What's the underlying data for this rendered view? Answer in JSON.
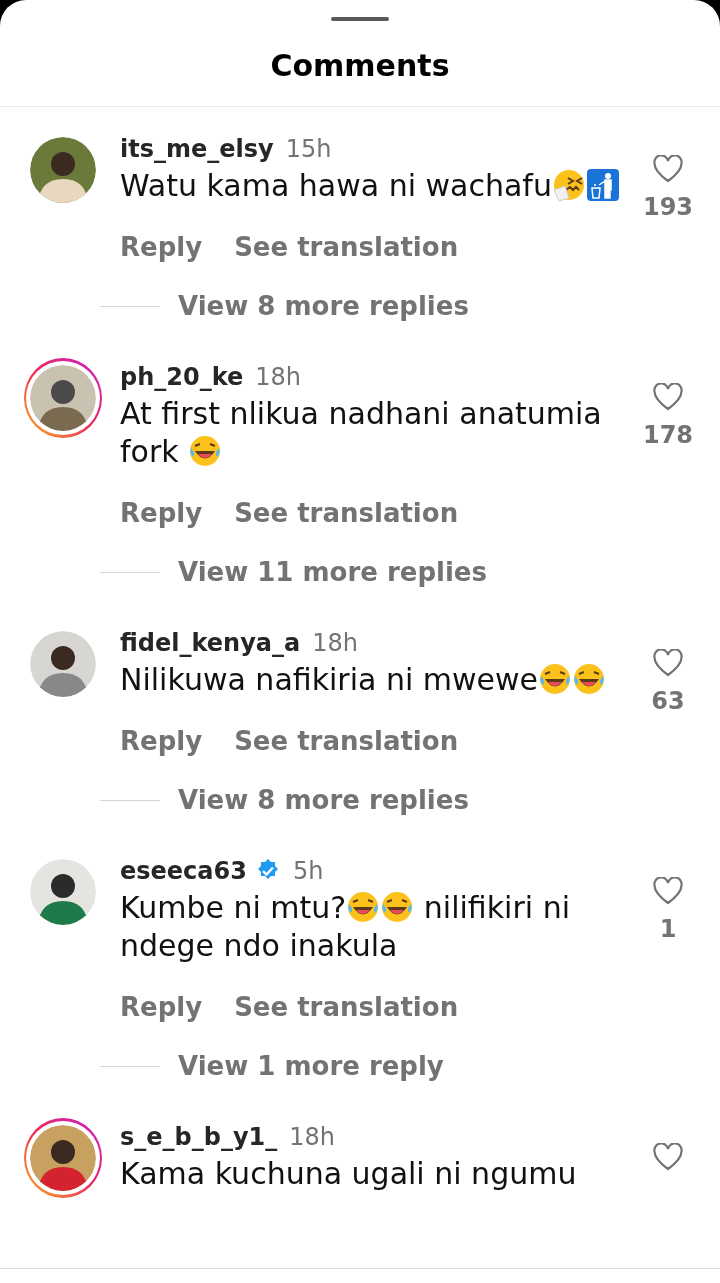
{
  "header": {
    "title": "Comments"
  },
  "comments": [
    {
      "username": "its_me_elsy",
      "verified": false,
      "time": "15h",
      "has_story": false,
      "liked": false,
      "likes": "193",
      "text": [
        {
          "kind": "text",
          "text": "Watu kama hawa ni wachafu"
        },
        {
          "kind": "sneeze"
        },
        {
          "kind": "litter"
        }
      ],
      "actions": [
        "Reply",
        "See translation"
      ],
      "replies": "View 8 more replies"
    },
    {
      "username": "ph_20_ke",
      "verified": false,
      "time": "18h",
      "has_story": true,
      "liked": false,
      "likes": "178",
      "text": [
        {
          "kind": "text",
          "text": "At first nlikua nadhani anatumia"
        },
        {
          "kind": "text",
          "text": "fork "
        },
        {
          "kind": "laugh"
        }
      ],
      "actions": [
        "Reply",
        "See translation"
      ],
      "replies": "View 11 more replies"
    },
    {
      "username": "fidel_kenya_a",
      "verified": false,
      "time": "18h",
      "has_story": false,
      "liked": false,
      "likes": "63",
      "text": [
        {
          "kind": "text",
          "text": "Nilikuwa nafikiria ni mwewe"
        },
        {
          "kind": "laugh"
        },
        {
          "kind": "laugh"
        }
      ],
      "actions": [
        "Reply",
        "See translation"
      ],
      "replies": "View 8 more replies"
    },
    {
      "username": "eseeca63",
      "verified": true,
      "time": "5h",
      "has_story": false,
      "liked": false,
      "likes": "1",
      "text": [
        {
          "kind": "text",
          "text": "Kumbe ni mtu?"
        },
        {
          "kind": "laugh"
        },
        {
          "kind": "laugh"
        },
        {
          "kind": "text",
          "text": " nilifikiri ni"
        },
        {
          "kind": "text",
          "text": "ndege ndo inakula"
        }
      ],
      "actions": [
        "Reply",
        "See translation"
      ],
      "replies": "View 1 more reply"
    },
    {
      "username": "s_e_b_b_y1_",
      "verified": false,
      "time": "18h",
      "has_story": true,
      "liked": false,
      "text": [
        {
          "kind": "text",
          "text": "Kama kuchuna ugali ni ngumu"
        }
      ]
    }
  ]
}
